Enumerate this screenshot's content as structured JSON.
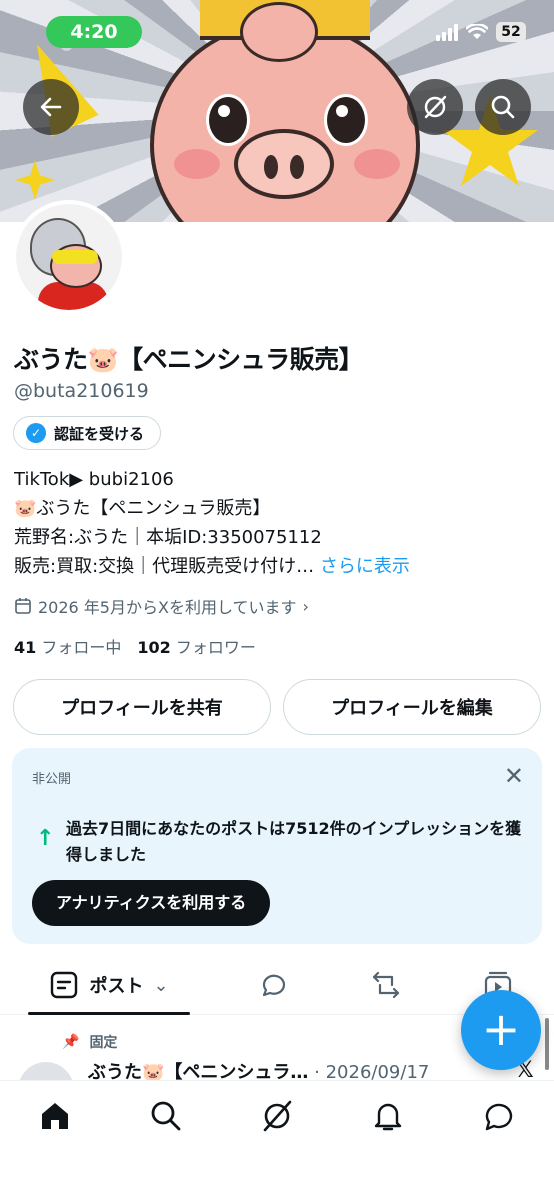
{
  "status_bar": {
    "time": "4:20",
    "battery": "52"
  },
  "profile": {
    "display_name": "ぶうた🐷【ペニンシュラ販売】",
    "handle": "@buta210619",
    "verify_button": "認証を受ける",
    "bio_lines": [
      "TikTok▶︎ bubi2106",
      "🐷ぶうた【ペニンシュラ販売】",
      "荒野名:ぶうた｜本垢ID:3350075112",
      "販売:買取:交換｜代理販売受け付け…"
    ],
    "bio_more": "さらに表示",
    "joined": "2026 年5月からXを利用しています",
    "following_count": "41",
    "following_label": "フォロー中",
    "followers_count": "102",
    "followers_label": "フォロワー"
  },
  "actions": {
    "share": "プロフィールを共有",
    "edit": "プロフィールを編集"
  },
  "analytics_card": {
    "tag": "非公開",
    "text": "過去7日間にあなたのポストは7512件のインプレッションを獲得しました",
    "button": "アナリティクスを利用する"
  },
  "tabs": {
    "posts": "ポスト"
  },
  "pinned_post": {
    "pinned_label": "固定",
    "author": "ぶうた🐷【ペニンシュラ…",
    "date": "· 2026/09/17"
  },
  "colors": {
    "accent": "#1d9bf0",
    "secondary_text": "#536471",
    "positive": "#00ba7c"
  }
}
